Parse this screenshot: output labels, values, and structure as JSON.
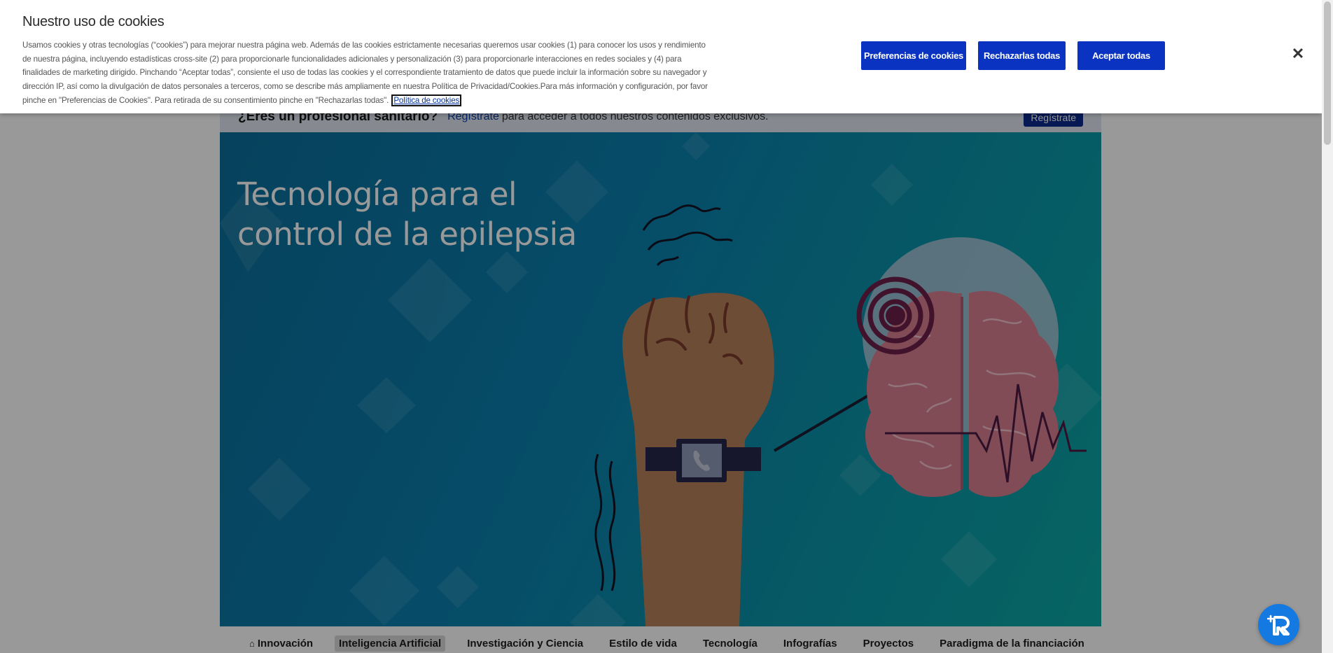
{
  "page": {
    "pro_bar": {
      "question": "¿Eres un profesional sanitario?",
      "register_link": "Regístrate",
      "register_text": "para acceder a todos nuestros contenidos exclusivos.",
      "register_button": "Regístrate"
    },
    "hero": {
      "title": "Tecnología para el control de la epilepsia"
    },
    "nav": {
      "items": [
        {
          "label": "Innovación",
          "icon": "home-icon"
        },
        {
          "label": "Inteligencia Artificial",
          "active": true
        },
        {
          "label": "Investigación y Ciencia"
        },
        {
          "label": "Estilo de vida"
        },
        {
          "label": "Tecnología"
        },
        {
          "label": "Infografías"
        },
        {
          "label": "Proyectos"
        },
        {
          "label": "Paradigma de la financiación"
        }
      ]
    }
  },
  "cookie_banner": {
    "title": "Nuestro uso de cookies",
    "text": "Usamos cookies y otras tecnologías (“cookies”) para mejorar nuestra página web. Además de las cookies estrictamente necesarias queremos usar cookies (1) para conocer los usos y rendimiento de nuestra página, incluyendo estadísticas cross-site (2) para proporcionarle funcionalidades adicionales y personalización (3) para proporcionarle interacciones en redes sociales y (4) para finalidades de marketing dirigido. Pinchando “Aceptar todas”, consiente el uso de todas las cookies y el correspondiente tratamiento de datos que puede incluir la información sobre su navegador y dirección IP, así como la divulgación de datos personales a terceros, como se describe más ampliamente en nuestra Política de Privacidad/Cookies.Para más información y configuración, por favor pinche en \"Preferencias de Cookies\". Para retirada de su consentimiento pinche en \"Rechazarlas todas\".",
    "policy_link": "Política de cookies",
    "buttons": {
      "preferences": "Preferencias de cookies",
      "reject": "Rechazarlas todas",
      "accept": "Aceptar todas"
    },
    "close_icon": "close-icon"
  },
  "chat_widget": {
    "icon": "chat-assistant-icon"
  },
  "colors": {
    "primary_button": "#0a33c2",
    "hero_start": "#0a6e9a",
    "hero_end": "#0aa9a4"
  }
}
